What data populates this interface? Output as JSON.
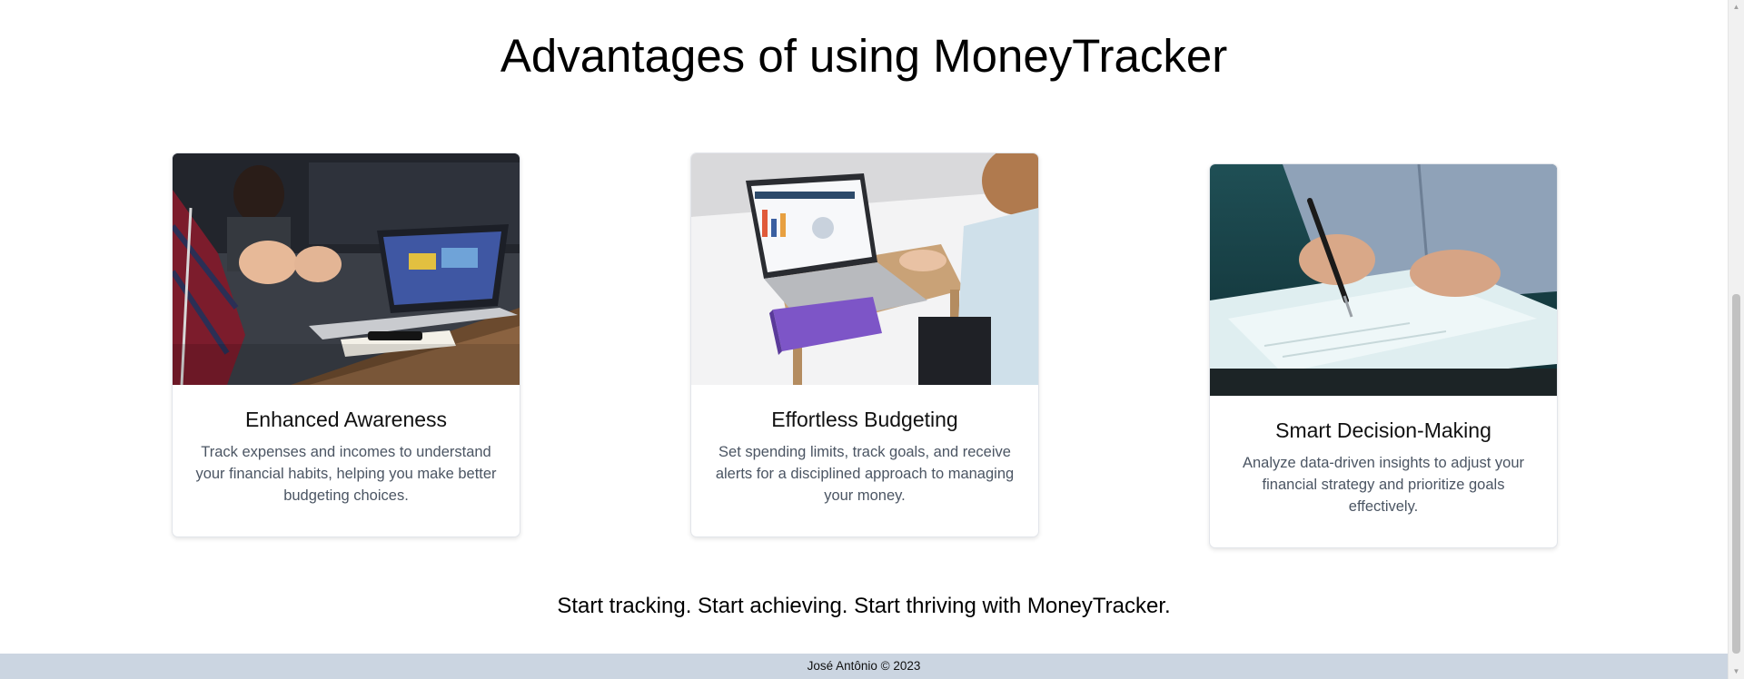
{
  "section": {
    "heading": "Advantages of using MoneyTracker"
  },
  "cards": [
    {
      "title": "Enhanced Awareness",
      "text": "Track expenses and incomes to understand your financial habits, helping you make better budgeting choices."
    },
    {
      "title": "Effortless Budgeting",
      "text": "Set spending limits, track goals, and receive alerts for a disciplined approach to managing your money."
    },
    {
      "title": "Smart Decision-Making",
      "text": "Analyze data-driven insights to adjust your financial strategy and prioritize goals effectively."
    }
  ],
  "tagline": "Start tracking. Start achieving. Start thriving with MoneyTracker.",
  "footer": {
    "text": "José Antônio © 2023"
  },
  "colors": {
    "footer_bg": "#cbd5e1",
    "card_text": "#4b5563"
  }
}
